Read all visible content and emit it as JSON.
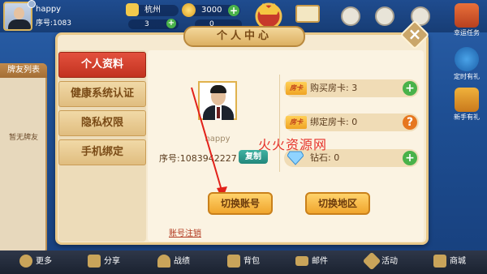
{
  "top_bar": {
    "user_name": "happy",
    "user_serial": "序号:1083",
    "city": "杭州",
    "coins": "3000",
    "room_cards": "3",
    "diamonds": "0"
  },
  "friend_panel": {
    "title": "牌友列表",
    "empty_text": "暂无牌友"
  },
  "right_side": {
    "items": [
      {
        "label": "幸运任务"
      },
      {
        "label": "定时有礼"
      },
      {
        "label": "新手有礼"
      }
    ]
  },
  "dialog": {
    "title": "个人中心",
    "menu": [
      {
        "label": "个人资料",
        "active": true
      },
      {
        "label": "健康系统认证",
        "active": false
      },
      {
        "label": "隐私权限",
        "active": false
      },
      {
        "label": "手机绑定",
        "active": false
      }
    ],
    "profile": {
      "name": "happy",
      "serial": "序号:1083942227",
      "copy_label": "复制"
    },
    "stats": [
      {
        "icon": "房卡",
        "label": "购买房卡: 3",
        "action": "+"
      },
      {
        "icon": "房卡",
        "label": "绑定房卡: 0",
        "action": "?"
      },
      {
        "icon": "diamond",
        "label": "钻石:  0",
        "action": "+"
      }
    ],
    "switch_account_label": "切换账号",
    "switch_region_label": "切换地区",
    "logout_label": "账号注销",
    "watermark": "火火资源网"
  },
  "bottom_bar": {
    "items": [
      {
        "label": "更多"
      },
      {
        "label": "分享"
      },
      {
        "label": "战绩"
      },
      {
        "label": "背包"
      },
      {
        "label": "邮件"
      },
      {
        "label": "活动"
      },
      {
        "label": "商城"
      }
    ]
  },
  "colors": {
    "accent_red": "#c2331f",
    "gold": "#e0b24d",
    "green": "#49b24a",
    "orange_q": "#e6761f"
  }
}
